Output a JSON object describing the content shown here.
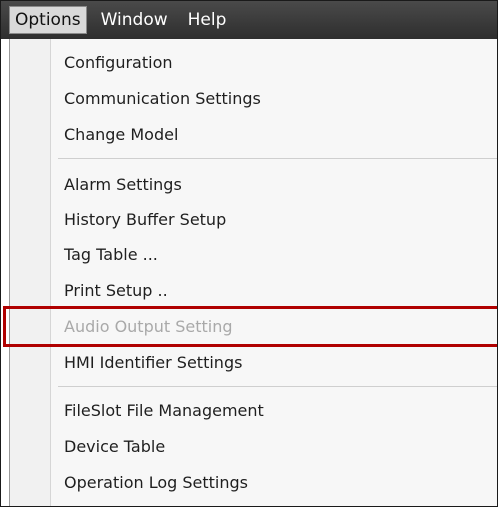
{
  "menubar": {
    "items": [
      {
        "label": "Options",
        "active": true
      },
      {
        "label": "Window",
        "active": false
      },
      {
        "label": "Help",
        "active": false
      }
    ]
  },
  "dropdown": {
    "groups": [
      [
        "Configuration",
        "Communication Settings",
        "Change Model"
      ],
      [
        "Alarm Settings",
        "History Buffer Setup",
        "Tag Table ...",
        "Print Setup ..",
        "Audio Output Setting",
        "HMI Identifier Settings"
      ],
      [
        "FileSlot File Management",
        "Device Table",
        "Operation Log Settings"
      ]
    ],
    "items": {
      "configuration": "Configuration",
      "communication_settings": "Communication Settings",
      "change_model": "Change Model",
      "alarm_settings": "Alarm Settings",
      "history_buffer_setup": "History Buffer Setup",
      "tag_table": "Tag Table ...",
      "print_setup": "Print Setup ..",
      "audio_output_setting": "Audio Output Setting",
      "hmi_identifier_settings": "HMI Identifier Settings",
      "fileslot_file_management": "FileSlot File Management",
      "device_table": "Device Table",
      "operation_log_settings": "Operation Log Settings"
    },
    "disabled_items": [
      "Audio Output Setting"
    ],
    "highlighted_item": "Audio Output Setting"
  },
  "colors": {
    "menubar_bg": "#333333",
    "active_menu_bg": "#d9d9d9",
    "disabled_text": "#a9a9a9",
    "highlight_border": "#b00000"
  }
}
